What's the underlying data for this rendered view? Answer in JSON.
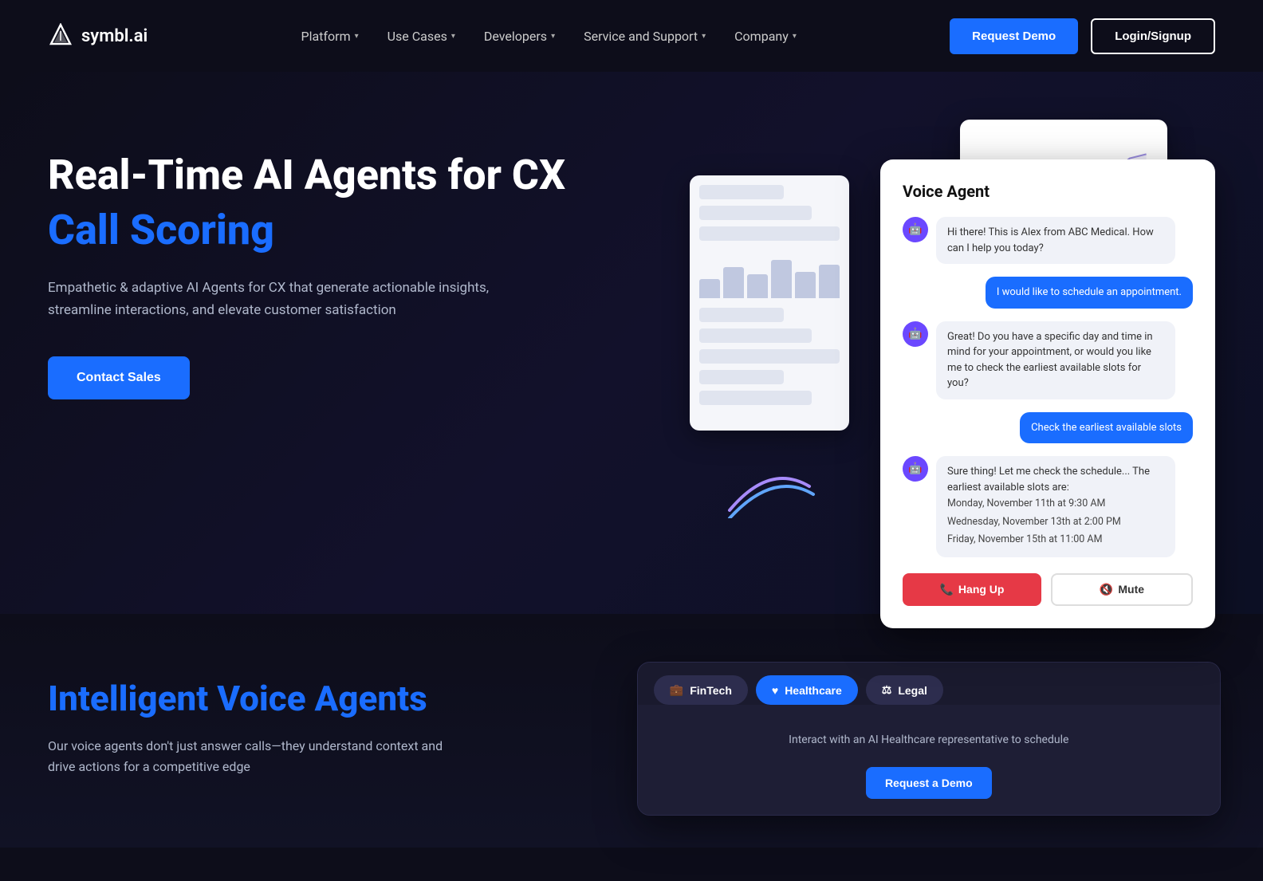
{
  "nav": {
    "logo_text": "symbl.ai",
    "items": [
      {
        "label": "Platform",
        "has_dropdown": true
      },
      {
        "label": "Use Cases",
        "has_dropdown": true
      },
      {
        "label": "Developers",
        "has_dropdown": true
      },
      {
        "label": "Service and Support",
        "has_dropdown": true
      },
      {
        "label": "Company",
        "has_dropdown": true
      }
    ],
    "request_demo_label": "Request Demo",
    "login_label": "Login/Signup"
  },
  "hero": {
    "title_line1": "Real-Time AI Agents for CX",
    "title_line2": "Call Scoring",
    "description": "Empathetic & adaptive AI Agents for CX that generate actionable insights, streamline interactions, and elevate customer satisfaction",
    "cta_label": "Contact Sales"
  },
  "voice_agent_card": {
    "title": "Voice Agent",
    "messages": [
      {
        "sender": "agent",
        "text": "Hi there! This is Alex from ABC Medical. How can I help you today?"
      },
      {
        "sender": "user",
        "text": "I would like to schedule an appointment."
      },
      {
        "sender": "agent",
        "text": "Great! Do you have a specific day and time in mind for your appointment, or would you like me to check the earliest available slots for you?"
      },
      {
        "sender": "user",
        "text": "Check the earliest available slots"
      },
      {
        "sender": "agent",
        "text": "Sure thing! Let me check the schedule... The earliest available slots are:",
        "slots": [
          "Monday, November 11th at 9:30 AM",
          "Wednesday, November 13th at 2:00 PM",
          "Friday, November 15th at 11:00 AM"
        ]
      }
    ],
    "hang_up_label": "Hang Up",
    "mute_label": "Mute"
  },
  "section2": {
    "title_static": "Intelligent",
    "title_highlight": "Voice Agents",
    "description": "Our voice agents don't just answer calls—they understand context and drive actions for a competitive edge"
  },
  "bottom_card": {
    "tabs": [
      {
        "label": "FinTech",
        "icon": "💼",
        "active": false
      },
      {
        "label": "Healthcare",
        "icon": "♥",
        "active": true
      },
      {
        "label": "Legal",
        "icon": "⚖",
        "active": false
      }
    ],
    "content_text": "Interact with an AI Healthcare representative to schedule",
    "request_demo_label": "Request a Demo"
  },
  "colors": {
    "brand_blue": "#1a6dff",
    "accent_purple": "#6b48ff",
    "bg_dark": "#0d0d1a",
    "text_muted": "#b0b8cc"
  }
}
